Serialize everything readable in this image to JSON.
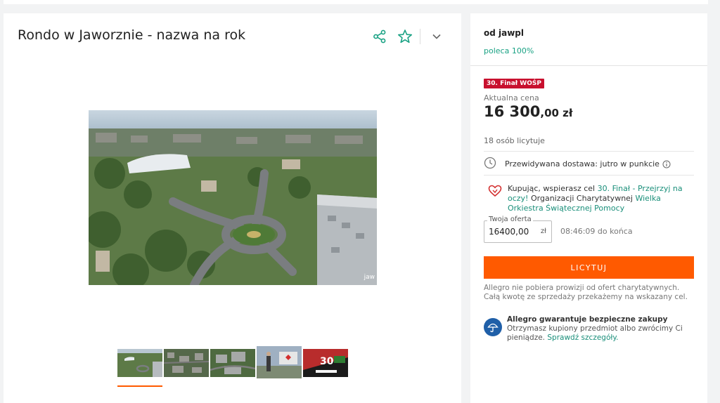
{
  "listing": {
    "title": "Rondo w Jaworznie - nazwa na rok",
    "photo_watermark": "jaw"
  },
  "thumbs": [
    {
      "name": "thumb-roundabout-aerial"
    },
    {
      "name": "thumb-city-aerial"
    },
    {
      "name": "thumb-buildings-aerial"
    },
    {
      "name": "thumb-person-sign"
    },
    {
      "name": "thumb-wosp-poster"
    }
  ],
  "seller": {
    "prefix": "od jawpl",
    "recommend": "poleca 100%"
  },
  "offer": {
    "badge": "30. Finał WOŚP",
    "price_label": "Aktualna cena",
    "price_main": "16 300",
    "price_decimal": ",00",
    "price_unit": " zł",
    "bidders": "18 osób licytuje",
    "delivery": "Przewidywana dostawa: jutro w punkcie",
    "charity_prefix": "Kupując, wspierasz cel ",
    "charity_goal": "30. Finał - Przejrzyj na oczy!",
    "charity_mid": " Organizacji Charytatywnej ",
    "charity_org": "Wielka Orkiestra Świątecznej Pomocy",
    "your_offer_label": "Twoja oferta",
    "your_offer_value": "16400,00",
    "your_offer_unit": "zł",
    "countdown": "08:46:09 do końca",
    "bid_button": "LICYTUJ",
    "note": "Allegro nie pobiera prowizji od ofert charytatywnych. Całą kwotę ze sprzedaży przekażemy na wskazany cel.",
    "guarantee_title": "Allegro gwarantuje bezpieczne zakupy",
    "guarantee_text": "Otrzymasz kupiony przedmiot albo zwrócimy Ci pieniądze. ",
    "guarantee_link": "Sprawdź szczegóły."
  },
  "colors": {
    "accent": "#ff5a00",
    "link": "#1a8f7a",
    "badge": "#c8102e",
    "guarantee": "#1f5fa8"
  },
  "icons": {
    "share": "share-icon",
    "star": "star-icon",
    "chevron": "chevron-down-icon",
    "clock": "clock-icon",
    "info": "info-icon",
    "heart": "heart-icon",
    "umbrella": "umbrella-icon"
  }
}
